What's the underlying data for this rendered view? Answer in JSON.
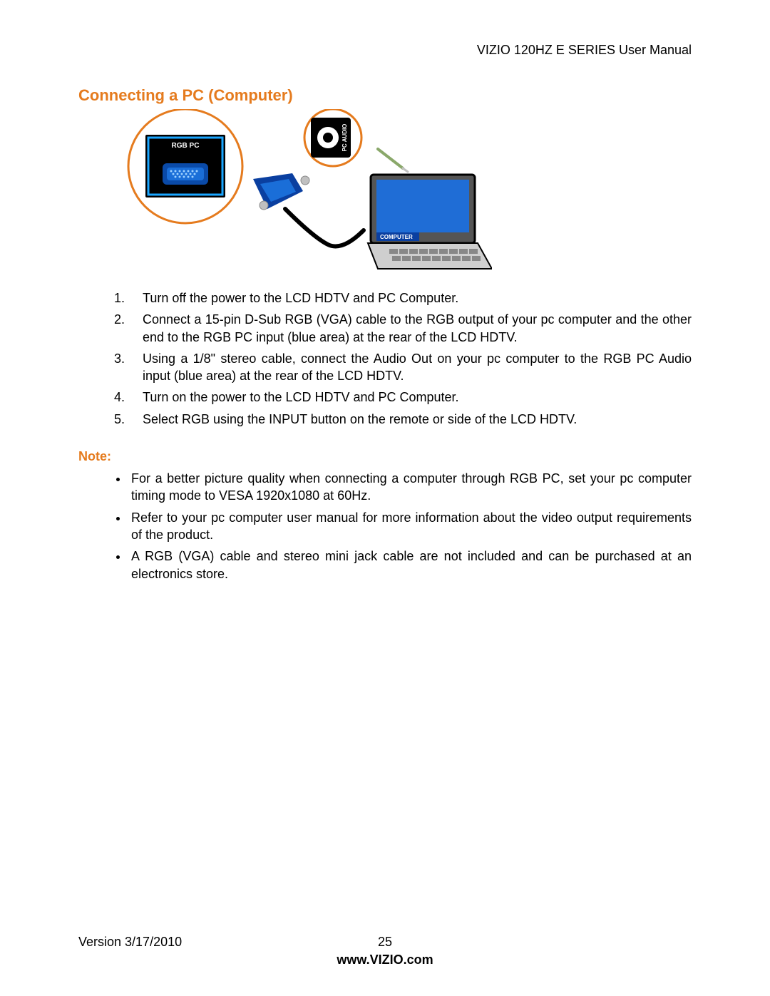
{
  "header": {
    "title": "VIZIO 120HZ E SERIES User Manual"
  },
  "section": {
    "heading": "Connecting a PC (Computer)"
  },
  "illustration": {
    "rgb_pc_label": "RGB PC",
    "pc_audio_label": "PC AUDIO",
    "computer_label": "COMPUTER"
  },
  "steps": {
    "items": [
      "Turn off the power to the LCD HDTV and PC Computer.",
      "Connect a 15-pin D-Sub RGB (VGA) cable to the RGB output of your pc computer and the other end to the RGB PC input (blue area) at the rear of the LCD HDTV.",
      "Using a 1/8\" stereo cable, connect the Audio Out on your pc computer to the RGB PC Audio input (blue area) at the rear of the LCD HDTV.",
      "Turn on the power to the LCD HDTV and PC Computer.",
      "Select RGB using the INPUT button on the remote or side of the LCD HDTV."
    ]
  },
  "note": {
    "heading": "Note:",
    "items": [
      "For a better picture quality when connecting a computer through RGB PC, set your pc computer timing mode to VESA 1920x1080 at 60Hz.",
      "Refer to your pc computer user manual for more information about the video output requirements of the product.",
      "A RGB (VGA) cable and stereo mini jack cable are not included and can be purchased at an electronics store."
    ]
  },
  "footer": {
    "version": "Version 3/17/2010",
    "page": "25",
    "url": "www.VIZIO.com"
  }
}
